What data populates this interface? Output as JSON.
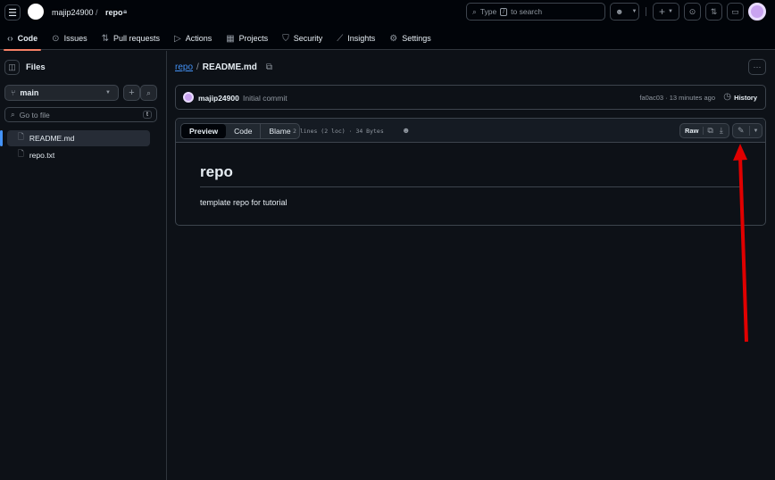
{
  "header": {
    "owner": "majip24900",
    "repo": "repo",
    "search_placeholder_pre": "Type",
    "search_key": "/",
    "search_placeholder_post": "to search"
  },
  "nav": [
    {
      "label": "Code",
      "icon": "code-icon"
    },
    {
      "label": "Issues",
      "icon": "issue-icon"
    },
    {
      "label": "Pull requests",
      "icon": "pull-request-icon"
    },
    {
      "label": "Actions",
      "icon": "play-icon"
    },
    {
      "label": "Projects",
      "icon": "table-icon"
    },
    {
      "label": "Security",
      "icon": "shield-icon"
    },
    {
      "label": "Insights",
      "icon": "graph-icon"
    },
    {
      "label": "Settings",
      "icon": "gear-icon"
    }
  ],
  "sidebar": {
    "title": "Files",
    "branch": "main",
    "filter_placeholder": "Go to file",
    "filter_key": "t",
    "files": [
      "README.md",
      "repo.txt"
    ]
  },
  "breadcrumb": {
    "repo": "repo",
    "sep": "/",
    "file": "README.md"
  },
  "commit": {
    "author": "majip24900",
    "message": "Initial commit",
    "meta": "fa0ac03 · 13 minutes ago",
    "history": "History"
  },
  "file_toolbar": {
    "tabs": [
      "Preview",
      "Code",
      "Blame"
    ],
    "info": "2 lines (2 loc) · 34 Bytes",
    "raw": "Raw"
  },
  "readme": {
    "heading": "repo",
    "body": "template repo for tutorial"
  },
  "colors": {
    "accent": "#f78166",
    "link": "#4493f8",
    "annotation": "#e00000"
  }
}
